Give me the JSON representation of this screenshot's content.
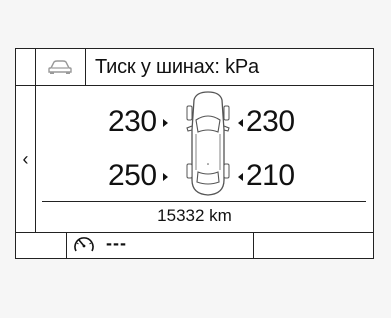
{
  "header": {
    "title": "Тиск у шинах: kPa",
    "icon": "car-icon"
  },
  "nav": {
    "back_label": "‹",
    "back_icon": "chevron-left-icon"
  },
  "tires": {
    "front_left": "230",
    "front_right": "230",
    "rear_left": "250",
    "rear_right": "210"
  },
  "odometer": {
    "value": "15332 km"
  },
  "footer": {
    "icon": "speedometer-icon",
    "value": "---"
  },
  "colors": {
    "line": "#222222",
    "text": "#111111",
    "background": "#ffffff"
  }
}
